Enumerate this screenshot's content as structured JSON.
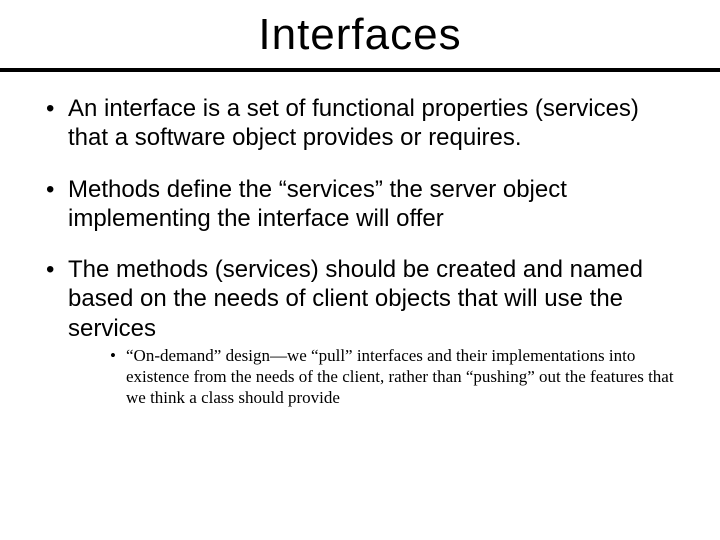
{
  "title": "Interfaces",
  "bullets": [
    {
      "text": "An interface is a set of functional properties (services) that a software object provides or requires."
    },
    {
      "text": "Methods define the “services” the server object implementing the interface will offer"
    },
    {
      "text": "The methods (services) should be created and named based on the needs of client objects that will use the services",
      "sub": [
        {
          "text": "“On-demand” design—we “pull” interfaces and their implementations into existence from the needs of the client, rather than “pushing” out the features that we think a class should provide"
        }
      ]
    }
  ]
}
